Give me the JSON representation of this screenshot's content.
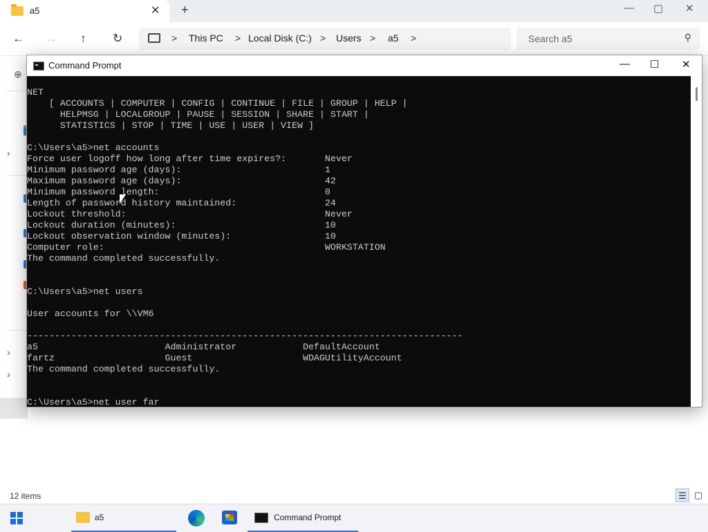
{
  "explorer": {
    "tab_title": "a5",
    "tab_close": "✕",
    "new_tab": "+",
    "window_controls": {
      "minimize": "—",
      "maximize": "▢",
      "close": "✕"
    },
    "nav": {
      "back": "←",
      "forward": "→",
      "up": "↑",
      "refresh": "↻"
    },
    "breadcrumb": [
      "This PC",
      "Local Disk (C:)",
      "Users",
      "a5"
    ],
    "breadcrumb_sep": ">",
    "search_placeholder": "Search a5",
    "status": "12 items"
  },
  "cmd": {
    "title": "Command Prompt",
    "controls": {
      "minimize": "—",
      "maximize": "☐",
      "close": "✕"
    },
    "lines": [
      "NET",
      "    [ ACCOUNTS | COMPUTER | CONFIG | CONTINUE | FILE | GROUP | HELP |",
      "      HELPMSG | LOCALGROUP | PAUSE | SESSION | SHARE | START |",
      "      STATISTICS | STOP | TIME | USE | USER | VIEW ]",
      "",
      "C:\\Users\\a5>net accounts",
      "Force user logoff how long after time expires?:       Never",
      "Minimum password age (days):                          1",
      "Maximum password age (days):                          42",
      "Minimum password length:                              0",
      "Length of password history maintained:                24",
      "Lockout threshold:                                    Never",
      "Lockout duration (minutes):                           10",
      "Lockout observation window (minutes):                 10",
      "Computer role:                                        WORKSTATION",
      "The command completed successfully.",
      "",
      "",
      "C:\\Users\\a5>net users",
      "",
      "User accounts for \\\\VM6",
      "",
      "-------------------------------------------------------------------------------",
      "a5                       Administrator            DefaultAccount",
      "fartz                    Guest                    WDAGUtilityAccount",
      "The command completed successfully.",
      "",
      "",
      "C:\\Users\\a5>net user far"
    ]
  },
  "taskbar": {
    "folder_label": "a5",
    "cmd_label": "Command Prompt",
    "accent": "#2f6fd1"
  },
  "icons": [
    "folder-icon",
    "back-icon",
    "forward-icon",
    "up-icon",
    "refresh-icon",
    "computer-icon",
    "search-icon",
    "windows-start-icon",
    "task-view-icon",
    "edge-icon",
    "store-icon",
    "command-prompt-icon"
  ]
}
